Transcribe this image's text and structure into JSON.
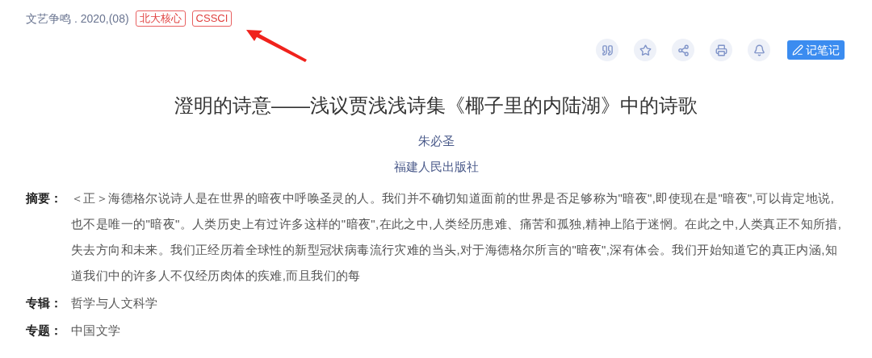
{
  "source": {
    "journal": "文艺争鸣",
    "issue": ". 2020,(08)"
  },
  "tags": [
    "北大核心",
    "CSSCI"
  ],
  "note_button": {
    "label": "记笔记"
  },
  "title": "澄明的诗意——浅议贾浅浅诗集《椰子里的内陆湖》中的诗歌",
  "author": "朱必圣",
  "organization": "福建人民出版社",
  "fields": [
    {
      "label": "摘要：",
      "value": "＜正＞海德格尔说诗人是在世界的暗夜中呼唤圣灵的人。我们并不确切知道面前的世界是否足够称为\"暗夜\",即使现在是\"暗夜\",可以肯定地说,也不是唯一的\"暗夜\"。人类历史上有过许多这样的\"暗夜\",在此之中,人类经历患难、痛苦和孤独,精神上陷于迷惘。在此之中,人类真正不知所措,失去方向和未来。我们正经历着全球性的新型冠状病毒流行灾难的当头,对于海德格尔所言的\"暗夜\",深有体会。我们开始知道它的真正内涵,知道我们中的许多人不仅经历肉体的疾难,而且我们的每"
    },
    {
      "label": "专辑：",
      "value": "哲学与人文科学"
    },
    {
      "label": "专题：",
      "value": "中国文学"
    }
  ]
}
